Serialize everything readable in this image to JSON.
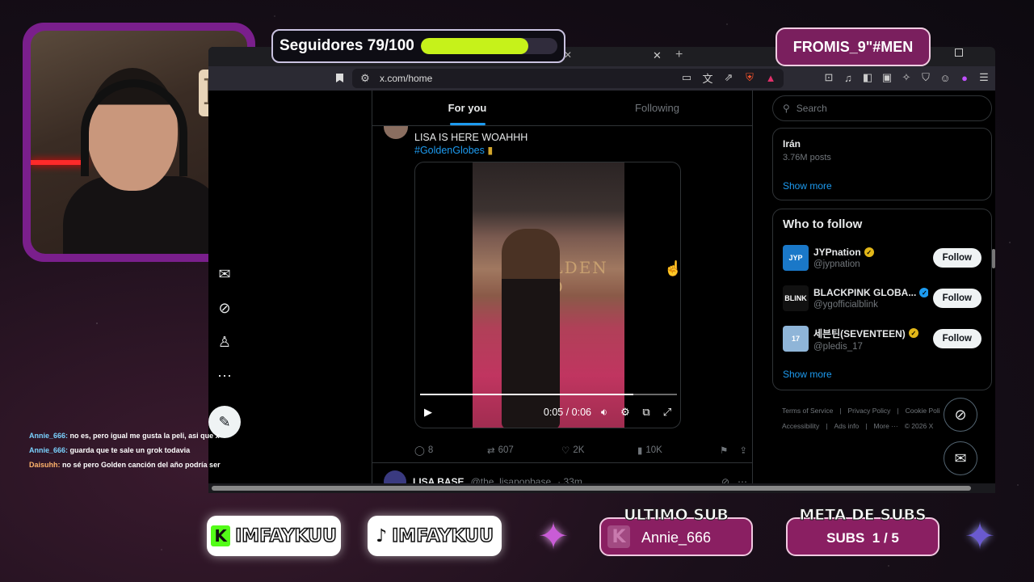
{
  "overlay": {
    "followers_label": "Seguidores 79/100",
    "followers_progress": 0.79,
    "top_tag": "FROMIS_9\"#MEN",
    "kick_handle": "IMFAYKUU",
    "tiktok_handle": "IMFAYKUU",
    "last_sub_title": "ULTIMO SUB",
    "last_sub_name": "Annie_666",
    "goal_title": "META DE SUBS",
    "goal_value": "SUBS  1 / 5",
    "colors": {
      "accent_purple": "#7a1f8c",
      "progress_green": "#c6f21a",
      "card_pink": "#8a1f62",
      "kick_green": "#53fc18"
    }
  },
  "chat": [
    {
      "user": "Annie_666:",
      "message": "no es, pero igual me gusta la peli, asi que x"
    },
    {
      "user": "Annie_666:",
      "message": "guarda que te sale un grok todavia"
    },
    {
      "user": "Daisuhh:",
      "message": "no sé pero Golden canción del año podría ser"
    }
  ],
  "browser": {
    "url": "x.com/home"
  },
  "x": {
    "tabs": [
      "For you",
      "Following"
    ],
    "active_tab": "For you",
    "tweet": {
      "text": "LISA IS HERE WOAHHH",
      "hashtag": "#GoldenGlobes",
      "video_time": "0:05 / 0:06",
      "video_progress": 0.83,
      "video_wall_text": "GOLDEN GLO",
      "replies": "8",
      "reposts": "607",
      "likes": "2K",
      "views": "10K"
    },
    "next_tweet": {
      "name": "LISA BASE",
      "handle": "@the_lisapopbase",
      "time": "· 33m"
    },
    "search_placeholder": "Search",
    "trend": {
      "name": "Irán",
      "count": "3.76M posts"
    },
    "show_more": "Show more",
    "who_to_follow_title": "Who to follow",
    "who_to_follow": [
      {
        "name": "JYPnation",
        "handle": "@jypnation",
        "button": "Follow",
        "avatar_text": "JYP",
        "avatar_color": "#1a78c8",
        "badge": "gold"
      },
      {
        "name": "BLACKPINK GLOBA...",
        "handle": "@ygofficialblink",
        "button": "Follow",
        "avatar_text": "BLINK",
        "avatar_color": "#111111",
        "badge": "blue"
      },
      {
        "name": "세븐틴(SEVENTEEN)",
        "handle": "@pledis_17",
        "button": "Follow",
        "avatar_text": "17",
        "avatar_color": "#8fb5d8",
        "badge": "gold"
      }
    ],
    "footer_row1": [
      "Terms of Service",
      "|",
      "Privacy Policy",
      "|",
      "Cookie Poli"
    ],
    "footer_row2": [
      "Accessibility",
      "|",
      "Ads info",
      "|",
      "More ···",
      "© 2026 X"
    ]
  }
}
